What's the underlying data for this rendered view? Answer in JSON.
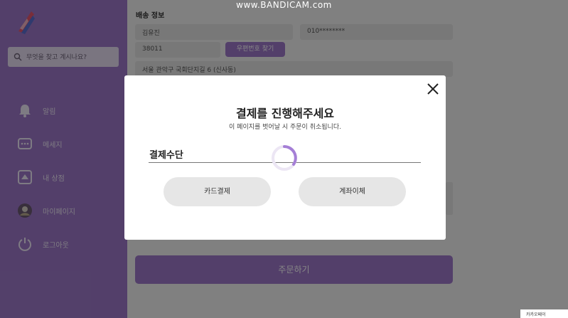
{
  "watermark": "www.BANDICAM.com",
  "sidebar": {
    "search_placeholder": "무엇을 찾고 계시나요?",
    "items": [
      {
        "label": "알림"
      },
      {
        "label": "메세지"
      },
      {
        "label": "내 상점"
      },
      {
        "label": "마이페이지"
      },
      {
        "label": "로그아웃"
      }
    ]
  },
  "form": {
    "section_title": "배송 정보",
    "name_value": "김유진",
    "phone_value": "010********",
    "zip_value": "38011",
    "zip_button": "우편번호 찾기",
    "address_value": "서울 관악구 국회단지길 6 (신사동)",
    "order_button": "주문하기"
  },
  "modal": {
    "title": "결제를 진행해주세요",
    "subtitle": "이 페이지를 벗어날 시 주문이 취소됩니다.",
    "method_label": "결제수단",
    "card_button": "카드결제",
    "bank_button": "계좌이체"
  },
  "popup": {
    "label": "카카오페이"
  },
  "colors": {
    "accent": "#9d78c8",
    "spinner": "#a57fd6"
  }
}
